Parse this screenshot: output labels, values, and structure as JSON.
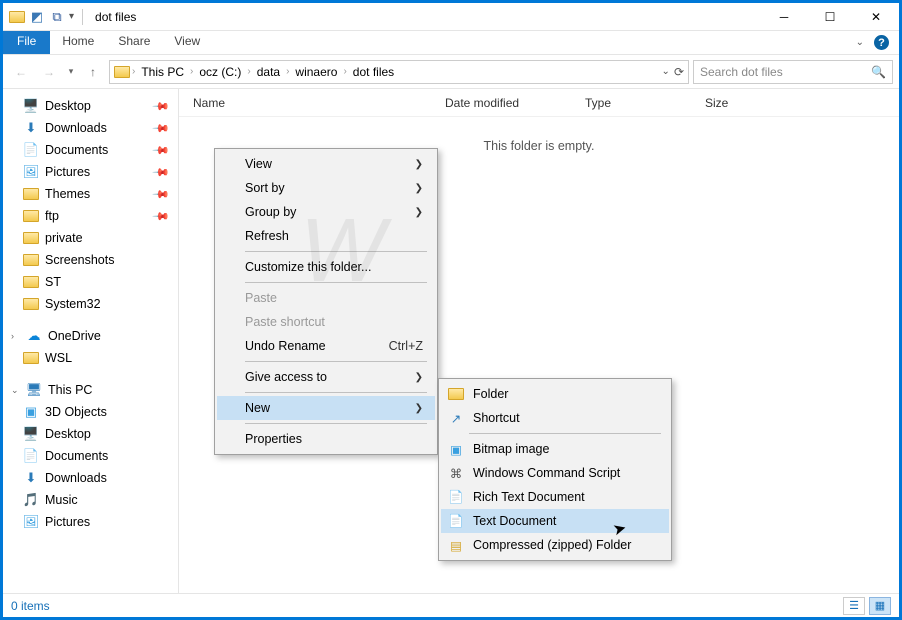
{
  "titlebar": {
    "title": "dot files"
  },
  "ribbon": {
    "file": "File",
    "tabs": [
      "Home",
      "Share",
      "View"
    ]
  },
  "nav": {
    "crumbs": [
      "This PC",
      "ocz (C:)",
      "data",
      "winaero",
      "dot files"
    ],
    "search_placeholder": "Search dot files"
  },
  "sidebar": {
    "quick": [
      {
        "label": "Desktop",
        "icon": "desktop",
        "pinned": true
      },
      {
        "label": "Downloads",
        "icon": "downloads",
        "pinned": true
      },
      {
        "label": "Documents",
        "icon": "documents",
        "pinned": true
      },
      {
        "label": "Pictures",
        "icon": "pictures",
        "pinned": true
      },
      {
        "label": "Themes",
        "icon": "folder",
        "pinned": true
      },
      {
        "label": "ftp",
        "icon": "folder",
        "pinned": true
      },
      {
        "label": "private",
        "icon": "folder",
        "pinned": false
      },
      {
        "label": "Screenshots",
        "icon": "folder",
        "pinned": false
      },
      {
        "label": "ST",
        "icon": "folder",
        "pinned": false
      },
      {
        "label": "System32",
        "icon": "folder",
        "pinned": false
      }
    ],
    "onedrive": "OneDrive",
    "onedrive_items": [
      {
        "label": "WSL",
        "icon": "folder"
      }
    ],
    "thispc": "This PC",
    "thispc_items": [
      {
        "label": "3D Objects",
        "icon": "3d"
      },
      {
        "label": "Desktop",
        "icon": "desktop"
      },
      {
        "label": "Documents",
        "icon": "documents"
      },
      {
        "label": "Downloads",
        "icon": "downloads"
      },
      {
        "label": "Music",
        "icon": "music"
      },
      {
        "label": "Pictures",
        "icon": "pictures"
      }
    ]
  },
  "columns": {
    "name": "Name",
    "date": "Date modified",
    "type": "Type",
    "size": "Size"
  },
  "empty_msg": "This folder is empty.",
  "status": {
    "items": "0 items"
  },
  "context_menu": {
    "items": [
      {
        "label": "View",
        "submenu": true
      },
      {
        "label": "Sort by",
        "submenu": true
      },
      {
        "label": "Group by",
        "submenu": true
      },
      {
        "label": "Refresh"
      },
      {
        "sep": true
      },
      {
        "label": "Customize this folder..."
      },
      {
        "sep": true
      },
      {
        "label": "Paste",
        "disabled": true
      },
      {
        "label": "Paste shortcut",
        "disabled": true
      },
      {
        "label": "Undo Rename",
        "shortcut": "Ctrl+Z"
      },
      {
        "sep": true
      },
      {
        "label": "Give access to",
        "submenu": true
      },
      {
        "sep": true
      },
      {
        "label": "New",
        "submenu": true,
        "selected": true
      },
      {
        "sep": true
      },
      {
        "label": "Properties"
      }
    ]
  },
  "new_submenu": {
    "items": [
      {
        "label": "Folder",
        "icon": "folder"
      },
      {
        "label": "Shortcut",
        "icon": "shortcut"
      },
      {
        "sep": true
      },
      {
        "label": "Bitmap image",
        "icon": "bmp"
      },
      {
        "label": "Windows Command Script",
        "icon": "cmd"
      },
      {
        "label": "Rich Text Document",
        "icon": "rtf"
      },
      {
        "label": "Text Document",
        "icon": "txt",
        "selected": true
      },
      {
        "label": "Compressed (zipped) Folder",
        "icon": "zip"
      }
    ]
  }
}
